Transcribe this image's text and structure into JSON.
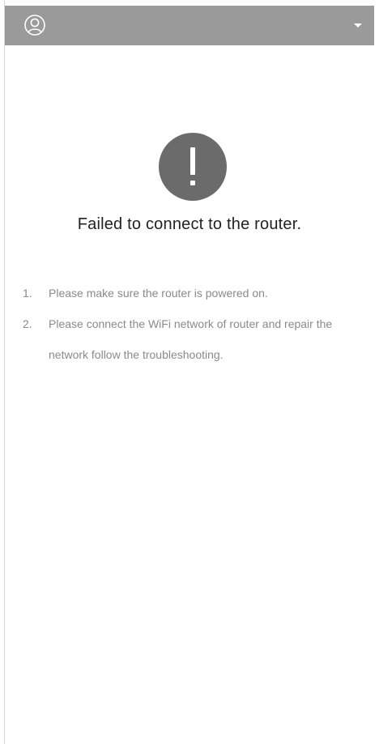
{
  "header": {
    "account_icon": "user-circle-icon",
    "menu_icon": "caret-down-icon"
  },
  "status": {
    "icon": "exclamation-icon",
    "title": "Failed to connect to the router."
  },
  "tips": [
    {
      "num": "1.",
      "text": "Please make sure the router is powered on."
    },
    {
      "num": "2.",
      "text": "Please connect the WiFi network of router and repair the network follow the troubleshooting."
    }
  ],
  "colors": {
    "header_bg": "#9a9a9a",
    "icon_bg": "#6b6b6b",
    "title_text": "#222222",
    "tip_text": "#8a8a8a"
  }
}
